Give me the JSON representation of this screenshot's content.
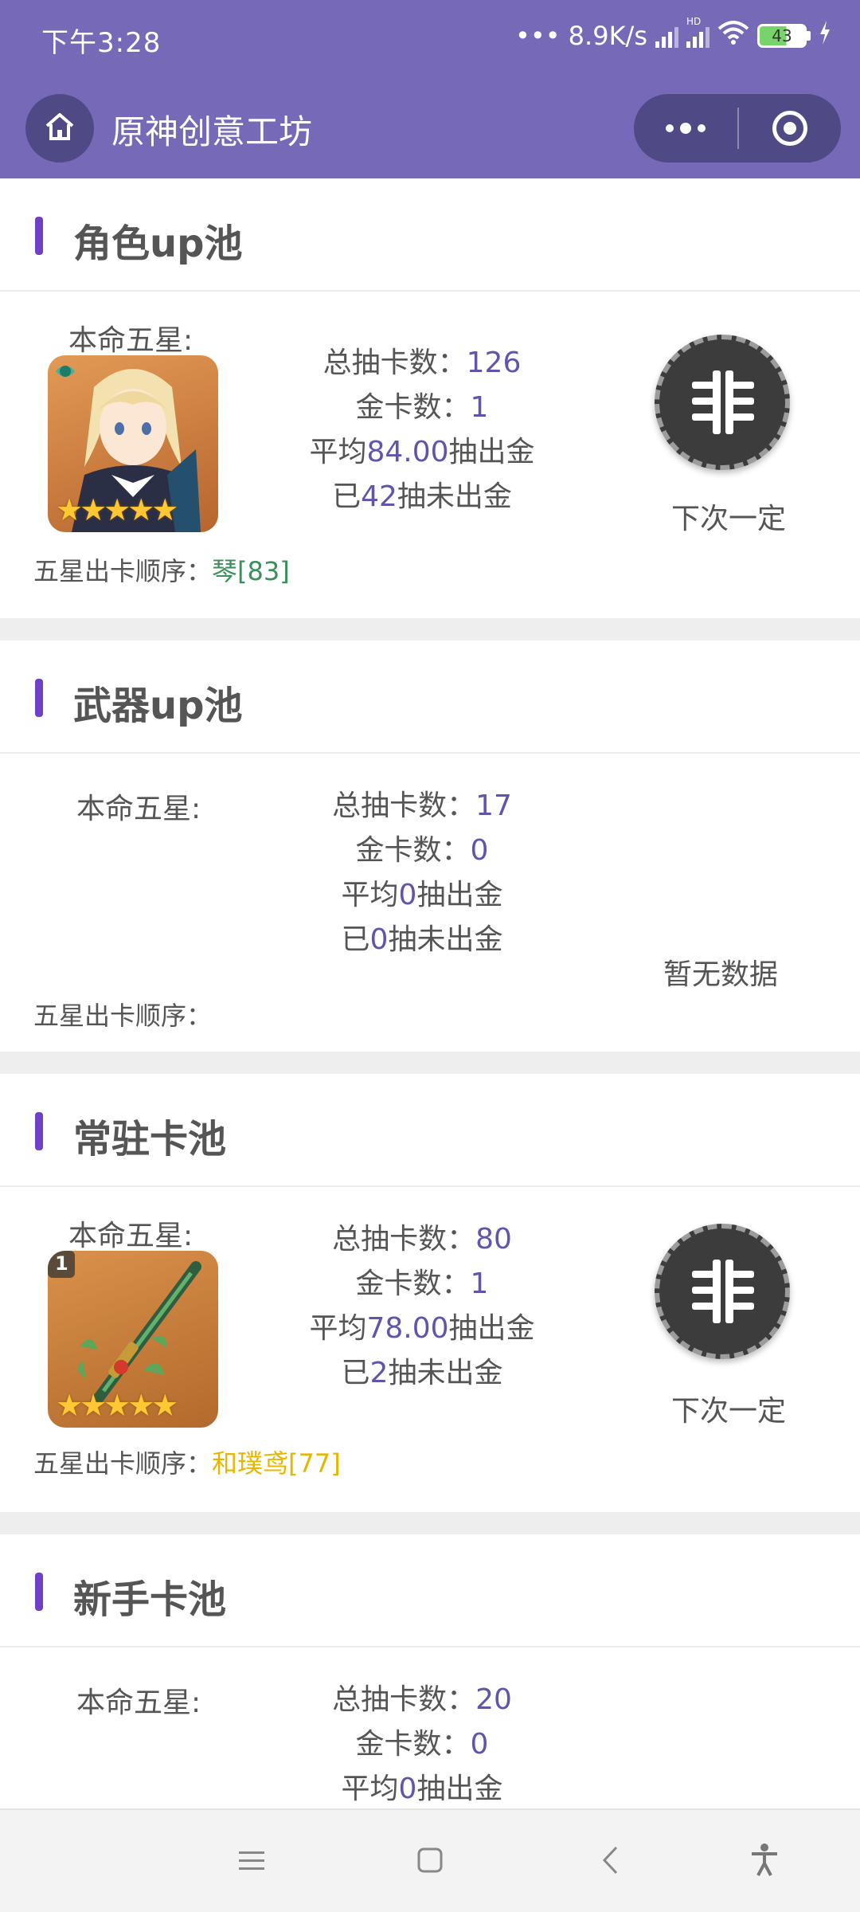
{
  "status": {
    "time": "下午3:28",
    "network_speed": "8.9K/s",
    "hd": "HD",
    "battery": "43"
  },
  "nav": {
    "title": "原神创意工坊"
  },
  "sections": [
    {
      "title": "角色up池",
      "five_star_label": "本命五星:",
      "stats": {
        "total_label": "总抽卡数：",
        "total": "126",
        "gold_label": "金卡数：",
        "gold": "1",
        "avg_prefix": "平均",
        "avg": "84.00",
        "avg_suffix": "抽出金",
        "since_prefix": "已",
        "since": "42",
        "since_suffix": "抽未出金"
      },
      "badge_text": "下次一定",
      "order_label": "五星出卡顺序：",
      "order_value": "琴[83]"
    },
    {
      "title": "武器up池",
      "five_star_label": "本命五星:",
      "stats": {
        "total_label": "总抽卡数：",
        "total": "17",
        "gold_label": "金卡数：",
        "gold": "0",
        "avg_prefix": "平均",
        "avg": "0",
        "avg_suffix": "抽出金",
        "since_prefix": "已",
        "since": "0",
        "since_suffix": "抽未出金"
      },
      "badge_text": "暂无数据",
      "order_label": "五星出卡顺序：",
      "order_value": ""
    },
    {
      "title": "常驻卡池",
      "five_star_label": "本命五星:",
      "stats": {
        "total_label": "总抽卡数：",
        "total": "80",
        "gold_label": "金卡数：",
        "gold": "1",
        "avg_prefix": "平均",
        "avg": "78.00",
        "avg_suffix": "抽出金",
        "since_prefix": "已",
        "since": "2",
        "since_suffix": "抽未出金"
      },
      "badge_text": "下次一定",
      "order_label": "五星出卡顺序：",
      "order_value": "和璞鸢[77]",
      "weapon_refine": "1"
    },
    {
      "title": "新手卡池",
      "five_star_label": "本命五星:",
      "stats": {
        "total_label": "总抽卡数：",
        "total": "20",
        "gold_label": "金卡数：",
        "gold": "0",
        "avg_prefix": "平均",
        "avg": "0",
        "avg_suffix": "抽出金"
      }
    }
  ],
  "icons": {
    "home": "home-icon",
    "more": "more-dots-icon",
    "close": "target-circle-icon",
    "badge": "fei-glyph-icon",
    "menu": "menu-icon",
    "home_square": "square-home-icon",
    "back": "back-chevron-icon",
    "accessibility": "accessibility-icon"
  },
  "colors": {
    "header": "#7569b8",
    "accent": "#6054ad",
    "section_bar": "#7040c8",
    "order_green": "#3b8f5a",
    "order_gold": "#e6b700"
  }
}
